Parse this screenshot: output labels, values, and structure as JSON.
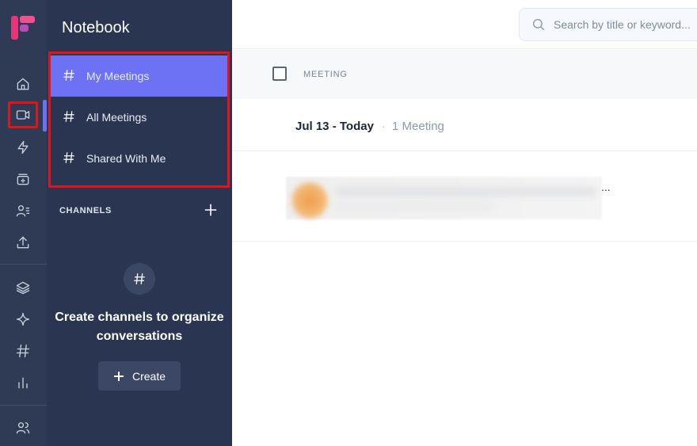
{
  "app": {
    "brand_color": "#e8357a",
    "accent": "#6d72f5"
  },
  "rail": {
    "items": [
      {
        "icon": "home-icon"
      },
      {
        "icon": "video-camera-icon",
        "active": true
      },
      {
        "icon": "lightning-icon"
      },
      {
        "icon": "meeting-box-icon"
      },
      {
        "icon": "people-list-icon"
      },
      {
        "icon": "upload-icon"
      },
      {
        "icon": "layers-icon"
      },
      {
        "icon": "sparkle-icon"
      },
      {
        "icon": "hashtag-icon"
      },
      {
        "icon": "bar-chart-icon"
      },
      {
        "icon": "team-icon"
      }
    ]
  },
  "sidebar": {
    "title": "Notebook",
    "items": [
      {
        "label": "My Meetings",
        "selected": true
      },
      {
        "label": "All Meetings"
      },
      {
        "label": "Shared With Me"
      }
    ],
    "channels_heading": "CHANNELS",
    "empty_text": "Create channels to organize conversations",
    "create_label": "Create"
  },
  "main": {
    "search_placeholder": "Search by title or keyword...",
    "column_meeting": "MEETING",
    "date_group": "Jul 13 - Today",
    "date_separator": "·",
    "meeting_count": "1 Meeting",
    "row_more": "..."
  }
}
